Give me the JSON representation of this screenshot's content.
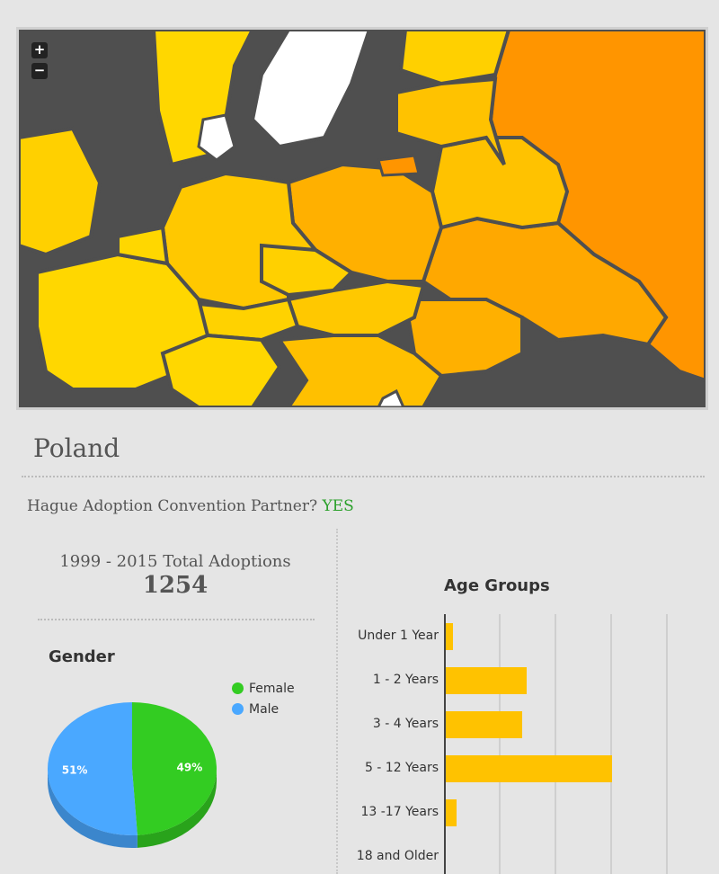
{
  "map": {
    "zoom_in_label": "+",
    "zoom_out_label": "−",
    "colors": {
      "water": "#4f4f4f",
      "border": "#4f4f4f",
      "scale_low": "#ffd700",
      "scale_mid": "#ffbf00",
      "scale_high": "#ff9500",
      "no_data": "#ffffff"
    }
  },
  "country": {
    "name": "Poland",
    "hague_question": "Hague Adoption Convention Partner?",
    "hague_answer": "YES"
  },
  "totals": {
    "label": "1999 - 2015 Total Adoptions",
    "value": "1254"
  },
  "gender_chart": {
    "title": "Gender",
    "legend": [
      {
        "label": "Female",
        "color": "#33cc22"
      },
      {
        "label": "Male",
        "color": "#4aa8ff"
      }
    ]
  },
  "age_chart": {
    "title": "Age Groups",
    "bar_color": "#ffc200"
  },
  "chart_data": [
    {
      "type": "pie",
      "title": "Gender",
      "categories": [
        "Female",
        "Male"
      ],
      "values": [
        49,
        51
      ],
      "labels": [
        "49%",
        "51%"
      ],
      "colors": [
        "#33cc22",
        "#4aa8ff"
      ],
      "legend": "top-right"
    },
    {
      "type": "bar",
      "orientation": "horizontal",
      "title": "Age Groups",
      "categories": [
        "Under 1 Year",
        "1 - 2 Years",
        "3 - 4 Years",
        "5 - 12 Years",
        "13 -17 Years",
        "18 and Older"
      ],
      "values": [
        8,
        90,
        85,
        185,
        12,
        0
      ],
      "xlim": [
        0,
        250
      ],
      "grid": true
    }
  ]
}
